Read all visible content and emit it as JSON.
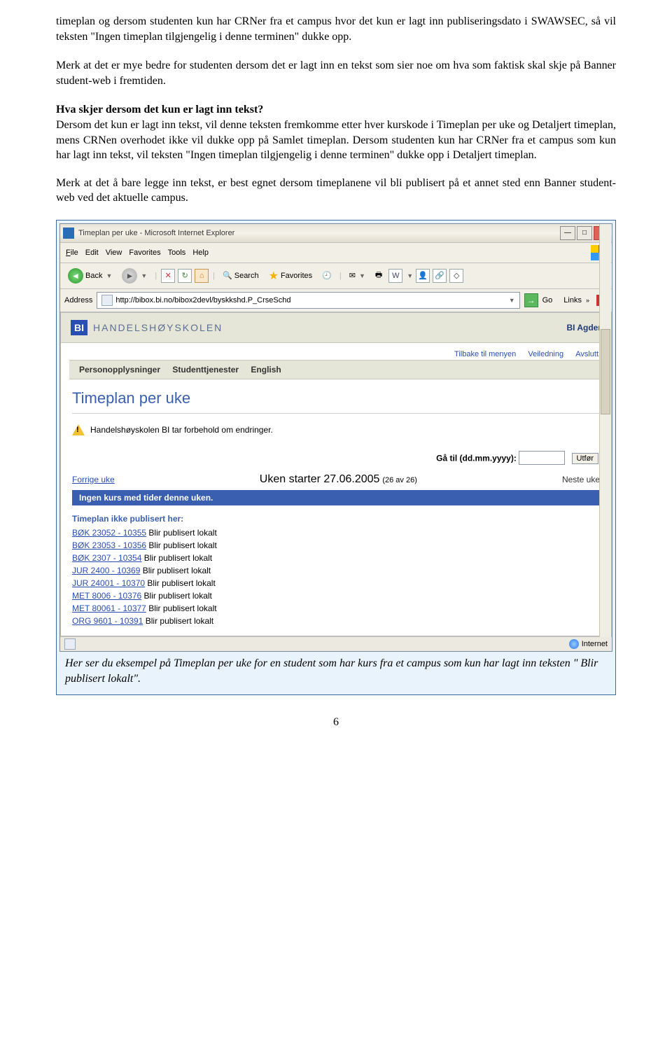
{
  "paragraphs": {
    "p1": "timeplan og dersom studenten kun har CRNer fra et campus hvor det kun er lagt inn publiseringsdato i SWAWSEC, så vil teksten \"Ingen timeplan tilgjengelig i denne terminen\" dukke opp.",
    "p2": "Merk at det er mye bedre for studenten dersom det er lagt inn en tekst som sier noe om hva som faktisk skal skje på Banner student-web i fremtiden.",
    "q3": "Hva skjer dersom det kun er lagt inn tekst?",
    "p3": "Dersom det kun er lagt inn tekst, vil denne teksten fremkomme etter hver kurskode i Timeplan per uke og Detaljert timeplan, mens CRNen overhodet ikke vil dukke opp på Samlet timeplan. Dersom studenten kun har CRNer fra et campus som kun har lagt inn tekst, vil teksten \"Ingen timeplan tilgjengelig i denne terminen\" dukke opp i Detaljert timeplan.",
    "p4": "Merk at det å bare legge inn tekst, er best egnet dersom timeplanene vil bli publisert på et annet sted enn Banner student-web ved det aktuelle campus."
  },
  "window": {
    "title": "Timeplan per uke - Microsoft Internet Explorer",
    "menu": {
      "file": "File",
      "edit": "Edit",
      "view": "View",
      "favorites": "Favorites",
      "tools": "Tools",
      "help": "Help"
    },
    "toolbar": {
      "back": "Back",
      "search": "Search",
      "favorites": "Favorites"
    },
    "address_label": "Address",
    "url": "http://bibox.bi.no/bibox2devl/byskkshd.P_CrseSchd",
    "go": "Go",
    "links": "Links",
    "status_zone": "Internet"
  },
  "bi": {
    "logo": "BI",
    "brand": "HANDELSHØYSKOLEN",
    "right": "BI Agder",
    "upper": {
      "tilbake": "Tilbake til menyen",
      "veiledning": "Veiledning",
      "avslutt": "Avslutt"
    },
    "nav": {
      "person": "Personopplysninger",
      "student": "Studenttjenester",
      "english": "English"
    },
    "title": "Timeplan per uke",
    "notice": "Handelshøyskolen BI tar forbehold om endringer.",
    "goto_label": "Gå til (dd.mm.yyyy):",
    "goto_btn": "Utfør",
    "prev": "Forrige uke",
    "week_main": "Uken starter 27.06.2005",
    "week_suffix": "(26 av 26)",
    "next": "Neste uke",
    "bluebar": "Ingen kurs med tider denne uken.",
    "section": "Timeplan ikke publisert her:",
    "courses": [
      {
        "code": "BØK 23052 - 10355",
        "txt": "Blir publisert lokalt"
      },
      {
        "code": "BØK 23053 - 10356",
        "txt": "Blir publisert lokalt"
      },
      {
        "code": "BØK 2307 - 10354",
        "txt": "Blir publisert lokalt"
      },
      {
        "code": "JUR 2400 - 10369",
        "txt": "Blir publisert lokalt"
      },
      {
        "code": "JUR 24001 - 10370",
        "txt": "Blir publisert lokalt"
      },
      {
        "code": "MET 8006 - 10376",
        "txt": "Blir publisert lokalt"
      },
      {
        "code": "MET 80061 - 10377",
        "txt": "Blir publisert lokalt"
      },
      {
        "code": "ORG 9601 - 10391",
        "txt": "Blir publisert lokalt"
      }
    ]
  },
  "caption": "Her ser du eksempel på Timeplan per uke for en student som har kurs fra et campus som kun har lagt inn teksten \" Blir publisert lokalt\".",
  "page_number": "6"
}
